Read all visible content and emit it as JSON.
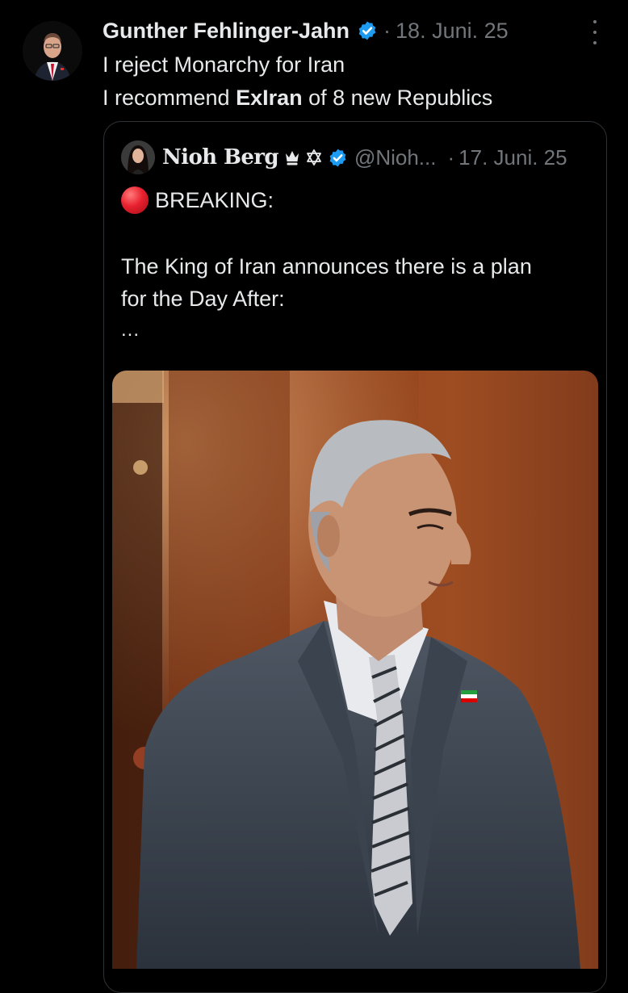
{
  "post": {
    "author_name": "Gunther Fehlinger-Jahn",
    "separator": "·",
    "date": "18. Juni. 25",
    "line1": "I reject Monarchy for Iran",
    "line2_prefix": "I recommend ",
    "line2_bold": "ExIran",
    "line2_suffix": " of 8 new Republics",
    "verified_icon": "verified-badge-icon",
    "more_icon": "more-options-icon"
  },
  "quote": {
    "author_name": "Nioh Berg",
    "emoji_icons": [
      "crown-icon",
      "star-of-david-icon"
    ],
    "verified_icon": "verified-badge-icon",
    "handle": "@Nioh...",
    "separator": "·",
    "date": "17. Juni. 25",
    "breaking_icon": "red-circle-icon",
    "breaking_label": "BREAKING:",
    "body_line1": "The King of Iran announces there is a plan",
    "body_line2": "for the Day After:",
    "ellipsis": "..."
  },
  "colors": {
    "background": "#000000",
    "text": "#e7e9ea",
    "muted": "#71767b",
    "verified": "#1d9bf0",
    "border": "#2f3336",
    "breaking_dot": "#e8212f"
  }
}
